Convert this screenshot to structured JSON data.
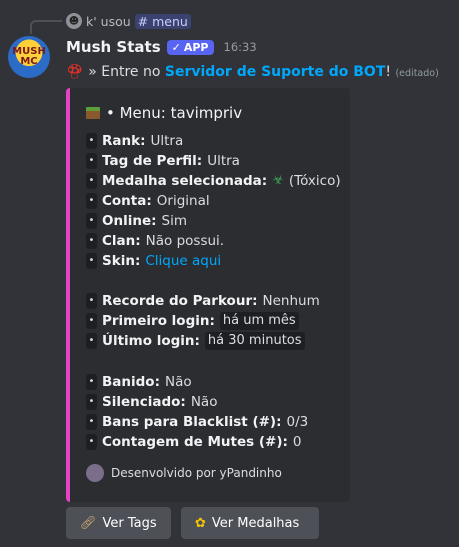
{
  "reply": {
    "user": "k' usou",
    "mention": "menu"
  },
  "message": {
    "bot_name": "Mush Stats",
    "badge": "APP",
    "time": "16:33",
    "avatar_text": "MUSH MC",
    "pre": "» Entre no",
    "link": "Servidor de Suporte do BOT",
    "post": "!",
    "edited": "(editado)"
  },
  "embed": {
    "accent": "#e443c4",
    "title": "• Menu: tavimpriv",
    "rows": [
      {
        "label": "Rank:",
        "value": "Ultra"
      },
      {
        "label": "Tag de Perfil:",
        "value": "Ultra"
      },
      {
        "label": "Medalha selecionada:",
        "value": "(Tóxico)"
      },
      {
        "label": "Conta:",
        "value": "Original"
      },
      {
        "label": "Online:",
        "value": "Sim"
      },
      {
        "label": "Clan:",
        "value": "Não possui."
      },
      {
        "label": "Skin:",
        "value": "Clique aqui"
      },
      {
        "label": "Recorde do Parkour:",
        "value": "Nenhum"
      },
      {
        "label": "Primeiro login:",
        "value": "há um mês"
      },
      {
        "label": "Último login:",
        "value": "há 30 minutos"
      },
      {
        "label": "Banido:",
        "value": "Não"
      },
      {
        "label": "Silenciado:",
        "value": "Não"
      },
      {
        "label": "Bans para Blacklist (#):",
        "value": "0/3"
      },
      {
        "label": "Contagem de Mutes (#):",
        "value": "0"
      }
    ],
    "footer": "Desenvolvido por yPandinho"
  },
  "buttons": {
    "tags": "Ver Tags",
    "medals": "Ver Medalhas"
  }
}
